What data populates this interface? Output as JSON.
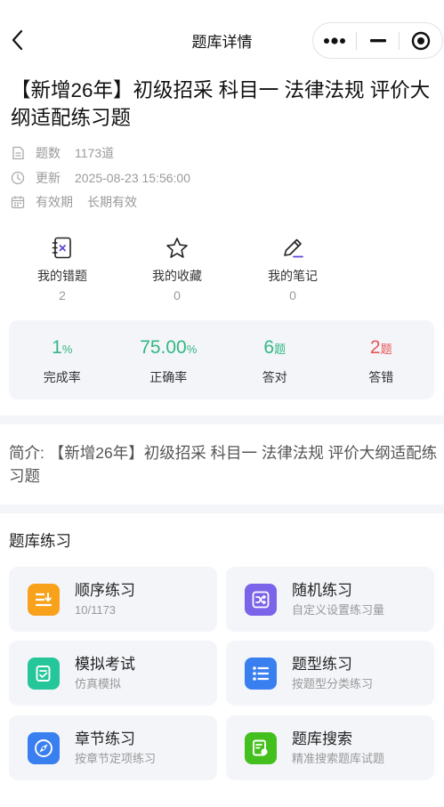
{
  "nav": {
    "title": "题库详情"
  },
  "bank": {
    "title": "【新增26年】初级招采 科目一 法律法规 评价大纲适配练习题",
    "meta": [
      {
        "icon": "document-icon",
        "label": "题数",
        "value": "1173道"
      },
      {
        "icon": "clock-icon",
        "label": "更新",
        "value": "2025-08-23 15:56:00"
      },
      {
        "icon": "calendar-icon",
        "label": "有效期",
        "value": "长期有效"
      }
    ],
    "intro": "简介: 【新增26年】初级招采 科目一 法律法规 评价大纲适配练习题"
  },
  "quick_links": [
    {
      "icon": "wrong-questions-icon",
      "label": "我的错题",
      "value": "2"
    },
    {
      "icon": "star-icon",
      "label": "我的收藏",
      "value": "0"
    },
    {
      "icon": "pencil-note-icon",
      "label": "我的笔记",
      "value": "0"
    }
  ],
  "stats": [
    {
      "value": "1",
      "unit": "%",
      "label": "完成率",
      "color": "#33b783"
    },
    {
      "value": "75.00",
      "unit": "%",
      "label": "正确率",
      "color": "#33b783"
    },
    {
      "value": "6",
      "unit": "题",
      "label": "答对",
      "color": "#33b783"
    },
    {
      "value": "2",
      "unit": "题",
      "label": "答错",
      "color": "#e85454"
    }
  ],
  "practice": {
    "title": "题库练习",
    "items": [
      {
        "icon": "sequential-list-icon",
        "color": "#f8a21c",
        "title": "顺序练习",
        "subtitle": "10/1173"
      },
      {
        "icon": "shuffle-icon",
        "color": "#7b63ea",
        "title": "随机练习",
        "subtitle": "自定义设置练习量"
      },
      {
        "icon": "exam-edit-icon",
        "color": "#25c69a",
        "title": "模拟考试",
        "subtitle": "仿真模拟"
      },
      {
        "icon": "list-icon",
        "color": "#3a7ff0",
        "title": "题型练习",
        "subtitle": "按题型分类练习"
      },
      {
        "icon": "compass-icon",
        "color": "#3a7ff0",
        "title": "章节练习",
        "subtitle": "按章节定项练习"
      },
      {
        "icon": "search-doc-icon",
        "color": "#44c01e",
        "title": "题库搜索",
        "subtitle": "精准搜索题库试题"
      }
    ]
  }
}
